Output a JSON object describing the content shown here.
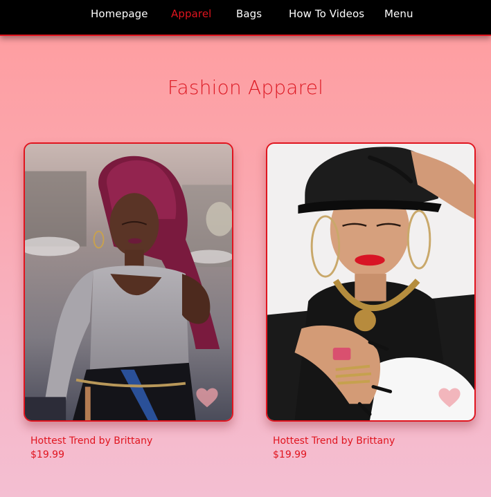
{
  "nav": {
    "items": [
      {
        "label": "Homepage",
        "active": false
      },
      {
        "label": "Apparel",
        "active": true
      },
      {
        "label": "Bags",
        "active": false
      },
      {
        "label": "How To Videos",
        "active": false
      },
      {
        "label": "Menu",
        "active": false
      }
    ]
  },
  "page": {
    "title": "Fashion Apparel"
  },
  "products": [
    {
      "name": "Hottest Trend by Brittany",
      "price": "$19.99",
      "favorite_icon": "heart-icon"
    },
    {
      "name": "Hottest Trend by Brittany",
      "price": "$19.99",
      "favorite_icon": "heart-icon"
    }
  ],
  "colors": {
    "accent": "#e0141e",
    "nav_background": "#000000",
    "nav_text": "#ffffff",
    "page_gradient_top": "#ff9c9e",
    "page_gradient_bottom": "#f4bfd2"
  }
}
